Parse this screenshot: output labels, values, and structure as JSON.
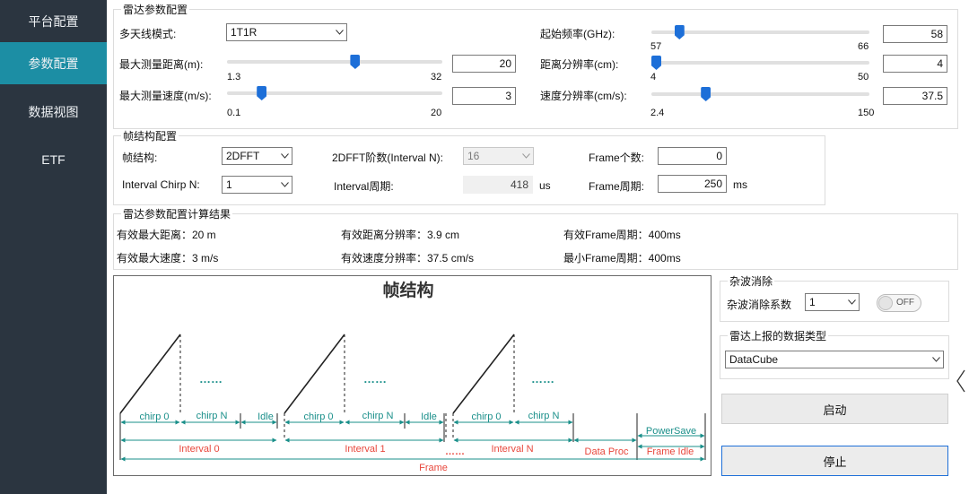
{
  "sidebar": {
    "items": [
      {
        "label": "平台配置",
        "active": false
      },
      {
        "label": "参数配置",
        "active": true
      },
      {
        "label": "数据视图",
        "active": false
      },
      {
        "label": "ETF",
        "active": false
      }
    ]
  },
  "radar_config": {
    "legend": "雷达参数配置",
    "antenna_mode": {
      "label": "多天线模式:",
      "value": "1T1R"
    },
    "max_range": {
      "label": "最大测量距离(m):",
      "min": "1.3",
      "max": "32",
      "value": "20",
      "level_fraction": 0.6
    },
    "max_speed": {
      "label": "最大测量速度(m/s):",
      "min": "0.1",
      "max": "20",
      "value": "3",
      "level_fraction": 0.145
    },
    "start_freq": {
      "label": "起始频率(GHz):",
      "min": "57",
      "max": "66",
      "value": "58",
      "level_fraction": 0.111
    },
    "range_res": {
      "label": "距离分辨率(cm):",
      "min": "4",
      "max": "50",
      "value": "4",
      "level_fraction": 0.0
    },
    "speed_res": {
      "label": "速度分辨率(cm/s):",
      "min": "2.4",
      "max": "150",
      "value": "37.5",
      "level_fraction": 0.238
    }
  },
  "frame_config": {
    "legend": "帧结构配置",
    "frame_structure": {
      "label": "帧结构:",
      "value": "2DFFT"
    },
    "fft_order": {
      "label": "2DFFT阶数(Interval N):",
      "value": "16"
    },
    "frame_count": {
      "label": "Frame个数:",
      "value": "0"
    },
    "interval_chirp": {
      "label": "Interval Chirp N:",
      "value": "1"
    },
    "interval_period": {
      "label": "Interval周期:",
      "value": "418",
      "unit": "us"
    },
    "frame_period": {
      "label": "Frame周期:",
      "value": "250",
      "unit": "ms"
    }
  },
  "results": {
    "legend": "雷达参数配置计算结果",
    "max_range": "有效最大距离：20 m",
    "range_res": "有效距离分辨率：3.9 cm",
    "frame_period": "有效Frame周期：400ms",
    "max_speed": "有效最大速度：3 m/s",
    "speed_res": "有效速度分辨率：37.5 cm/s",
    "min_frame_period": "最小Frame周期：400ms"
  },
  "diagram": {
    "title": "帧结构",
    "chirp0": "chirp 0",
    "chirpN": "chirp N",
    "idle": "Idle",
    "dots": "……",
    "interval0": "Interval 0",
    "interval1": "Interval 1",
    "intervalN": "Interval N",
    "data_proc": "Data Proc",
    "power_save": "PowerSave",
    "frame_idle": "Frame Idle",
    "frame": "Frame",
    "colors": {
      "teal": "#1a8f8a",
      "red": "#e8473c",
      "dark": "#222222"
    }
  },
  "clutter": {
    "legend": "杂波消除",
    "coef_label": "杂波消除系数",
    "coef_value": "1",
    "toggle_text": "OFF"
  },
  "report_type": {
    "legend": "雷达上报的数据类型",
    "value": "DataCube"
  },
  "buttons": {
    "start": "启动",
    "stop": "停止"
  },
  "collapse_icon": "chevron-left-icon"
}
